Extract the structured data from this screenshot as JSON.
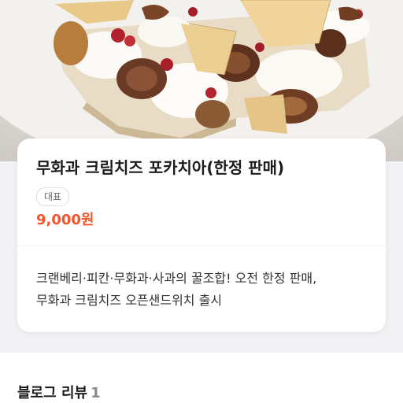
{
  "hero": {
    "image_name": "fig-cream-cheese-focaccia-photo"
  },
  "product": {
    "title": "무화과 크림치즈 포카치아(한정 판매)",
    "badge": "대표",
    "price": "9,000원",
    "price_color": "#f2552c",
    "description_lines": [
      "크랜베리·피칸·무화과·사과의 꿀조합! 오전 한정 판매,",
      "무화과 크림치즈 오픈샌드위치 출시"
    ]
  },
  "reviews": {
    "title": "블로그 리뷰",
    "count": "1"
  }
}
